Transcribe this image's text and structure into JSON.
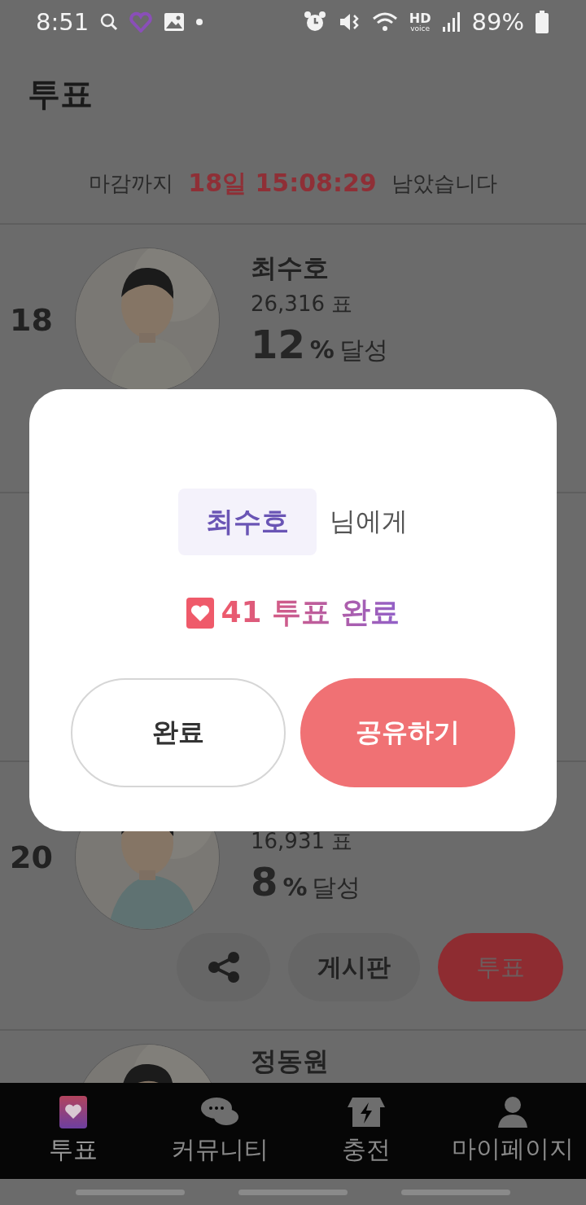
{
  "status_bar": {
    "time": "8:51",
    "battery": "89%",
    "hd_label": "HD",
    "voice_label": "voice"
  },
  "header": {
    "title": "투표"
  },
  "countdown": {
    "prefix": "마감까지",
    "time": "18일 15:08:29",
    "suffix": "남았습니다"
  },
  "candidates": [
    {
      "rank": "18",
      "name": "최수호",
      "votes": "26,316 표",
      "percent": "12",
      "percent_unit": "%",
      "percent_label": "달성",
      "kind": "picture"
    },
    {
      "kind": "blank"
    },
    {
      "rank": "20",
      "votes": "16,931 표",
      "percent": "8",
      "percent_unit": "%",
      "percent_label": "달성",
      "kind": "picture",
      "board_label": "게시판",
      "vote_label": "투표"
    },
    {
      "name": "정동원",
      "kind": "picture"
    }
  ],
  "dialog": {
    "name": "최수호",
    "name_suffix": "님에게",
    "result": "41 투표 완료",
    "buttons": [
      {
        "label": "완료",
        "kind": "outline"
      },
      {
        "label": "공유하기",
        "kind": "primary"
      }
    ]
  },
  "bottom_nav": [
    {
      "label": "투표",
      "kind": "vote",
      "selected": true
    },
    {
      "label": "커뮤니티",
      "kind": "chat",
      "selected": false
    },
    {
      "label": "충전",
      "kind": "shop",
      "selected": false
    },
    {
      "label": "마이페이지",
      "kind": "person",
      "selected": false
    }
  ]
}
